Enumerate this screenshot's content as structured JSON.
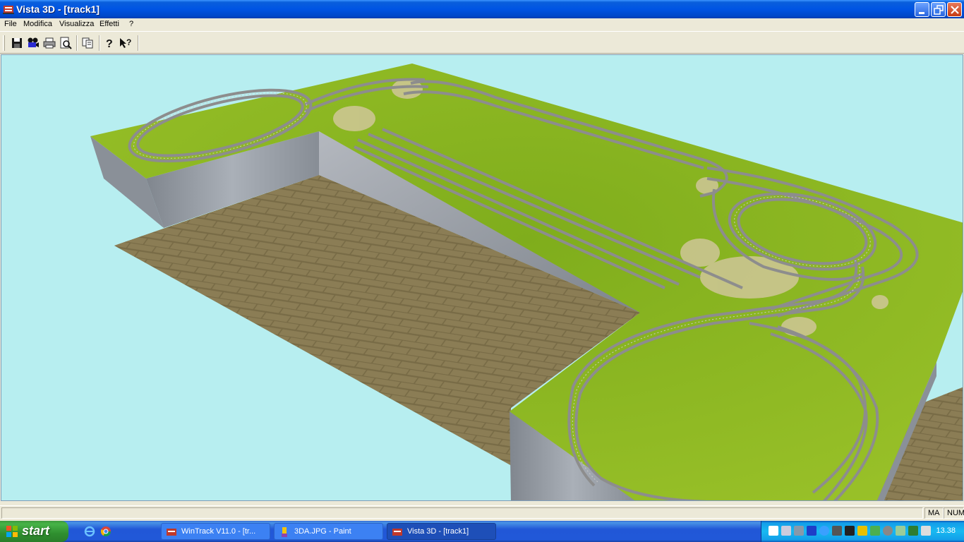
{
  "window": {
    "title": "Vista 3D - [track1]"
  },
  "menu": {
    "items": [
      {
        "label": "File"
      },
      {
        "label": "Modifica"
      },
      {
        "label": "Visualizza"
      },
      {
        "label": "Effetti"
      },
      {
        "label": "?"
      }
    ]
  },
  "toolbar": {
    "icons": [
      "save-icon",
      "camera-icon",
      "print-icon",
      "print-preview-icon",
      "copy-icon",
      "help-icon",
      "context-help-icon"
    ]
  },
  "status": {
    "main": "",
    "caps": "MA",
    "num": "NUM"
  },
  "taskbar": {
    "start_label": "start",
    "tasks": [
      {
        "label": "WinTrack  V11.0 - [tr..."
      },
      {
        "label": "3DA.JPG - Paint"
      },
      {
        "label": "Vista 3D - [track1]"
      }
    ],
    "clock": "13.38"
  },
  "colors": {
    "sky": "#b7eef0",
    "grass": "#8fb81f",
    "floor": "#8b7d55",
    "cliff": "#9aa0a8",
    "track": "#8d8d8d",
    "titlebar": "#0054e3",
    "taskbar": "#2157d7",
    "start": "#3c9a3c"
  }
}
